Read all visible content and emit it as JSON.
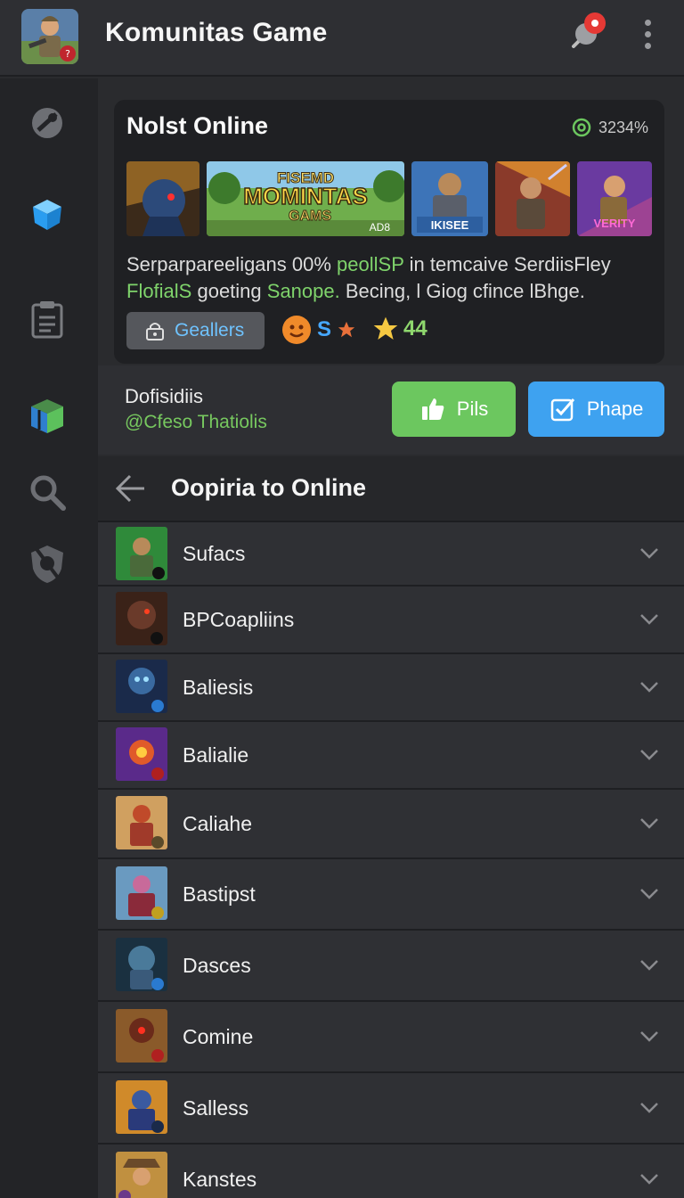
{
  "app": {
    "title": "Komunitas Game",
    "avatar_icon": "game-avatar",
    "notification_icon": "pin-notification",
    "menu_icon": "more-vertical"
  },
  "sidebar": {
    "items": [
      {
        "icon": "satellite-icon",
        "active": false
      },
      {
        "icon": "cube-icon",
        "active": true
      },
      {
        "icon": "clipboard-icon",
        "active": false
      },
      {
        "icon": "box-icon",
        "active": false
      },
      {
        "icon": "search-icon",
        "active": false
      },
      {
        "icon": "shield-icon",
        "active": false
      }
    ]
  },
  "card": {
    "title": "Nolst Online",
    "stat": "3234%",
    "banner_line1": "FISEMD",
    "banner_line2": "MOMINTAS",
    "banner_line3": "GAMS",
    "banner_badge": "AD8",
    "thumb_label_3": "IKISEE",
    "thumb_label_5": "VERITY",
    "desc_1": "Serparpareeligans 00% ",
    "desc_2": "peollSP",
    "desc_3": " in temcaive SerdiisFley",
    "desc_4": "FlofialS",
    "desc_5": " goeting ",
    "desc_6": "Sanope.",
    "desc_7": " Becing, l Giog cfince lBhge.",
    "gallery_label": "Geallers",
    "rating_letter": "S",
    "stars_value": "44"
  },
  "subrow": {
    "title": "Dofisidiis",
    "handle": "@Cfeso Thatiolis",
    "like_label": "Pils",
    "phase_label": "Phape"
  },
  "list": {
    "title": "Oopiria to Online",
    "items": [
      {
        "label": "Sufacs"
      },
      {
        "label": "BPCoapliins"
      },
      {
        "label": "Baliesis"
      },
      {
        "label": "Balialie"
      },
      {
        "label": "Caliahe"
      },
      {
        "label": "Bastipst"
      },
      {
        "label": "Dasces"
      },
      {
        "label": "Comine"
      },
      {
        "label": "Salless"
      },
      {
        "label": "Kanstes"
      }
    ]
  },
  "colors": {
    "accent_green": "#6cc75f",
    "accent_blue": "#3ea2f0",
    "background": "#2a2b2e"
  }
}
